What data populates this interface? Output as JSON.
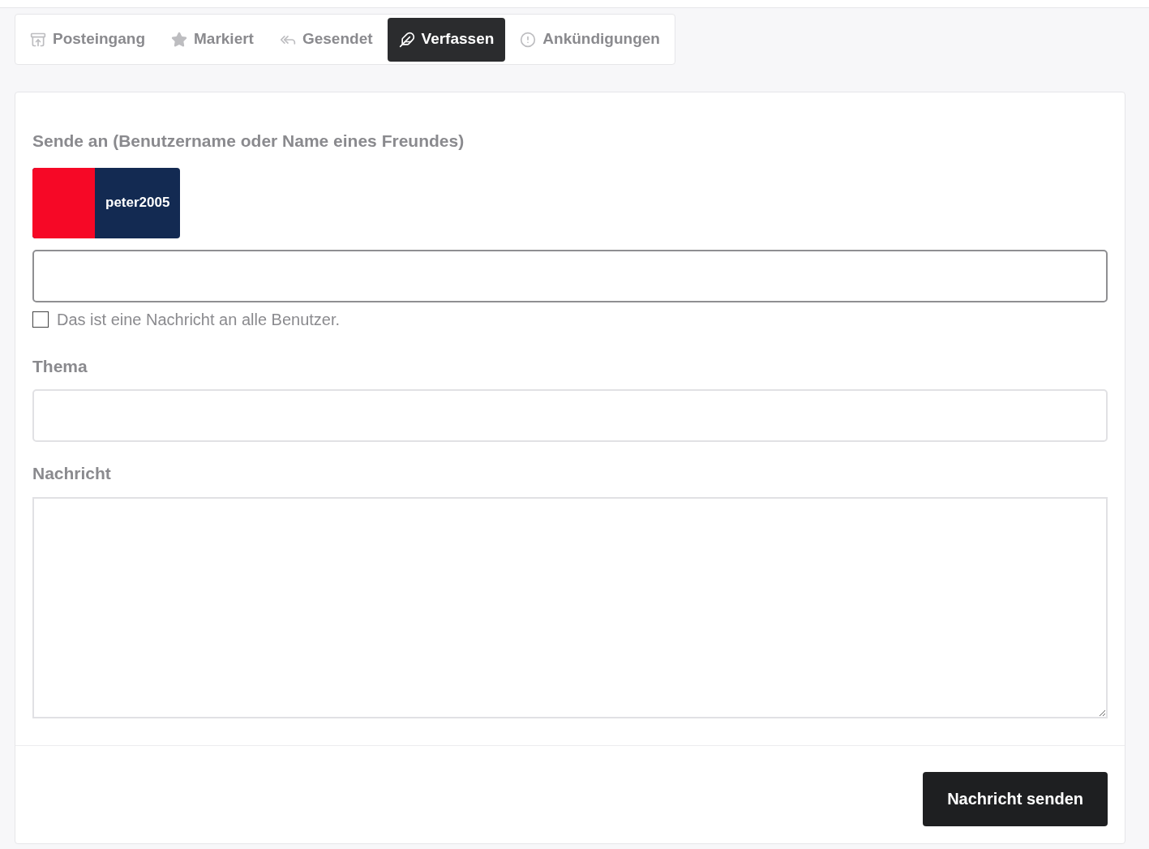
{
  "tabs": [
    {
      "label": "Posteingang",
      "selected": false
    },
    {
      "label": "Markiert",
      "selected": false
    },
    {
      "label": "Gesendet",
      "selected": false
    },
    {
      "label": "Verfassen",
      "selected": true
    },
    {
      "label": "Ankündigungen",
      "selected": false
    }
  ],
  "recipient": {
    "label": "Sende an (Benutzername oder Name eines Freundes)",
    "chips": [
      {
        "name": "peter2005"
      }
    ],
    "all_users": {
      "label": "Das ist eine Nachricht an alle Benutzer.",
      "checked": false
    }
  },
  "subject": {
    "label": "Thema"
  },
  "message": {
    "label": "Nachricht"
  },
  "send_button": "Nachricht senden"
}
